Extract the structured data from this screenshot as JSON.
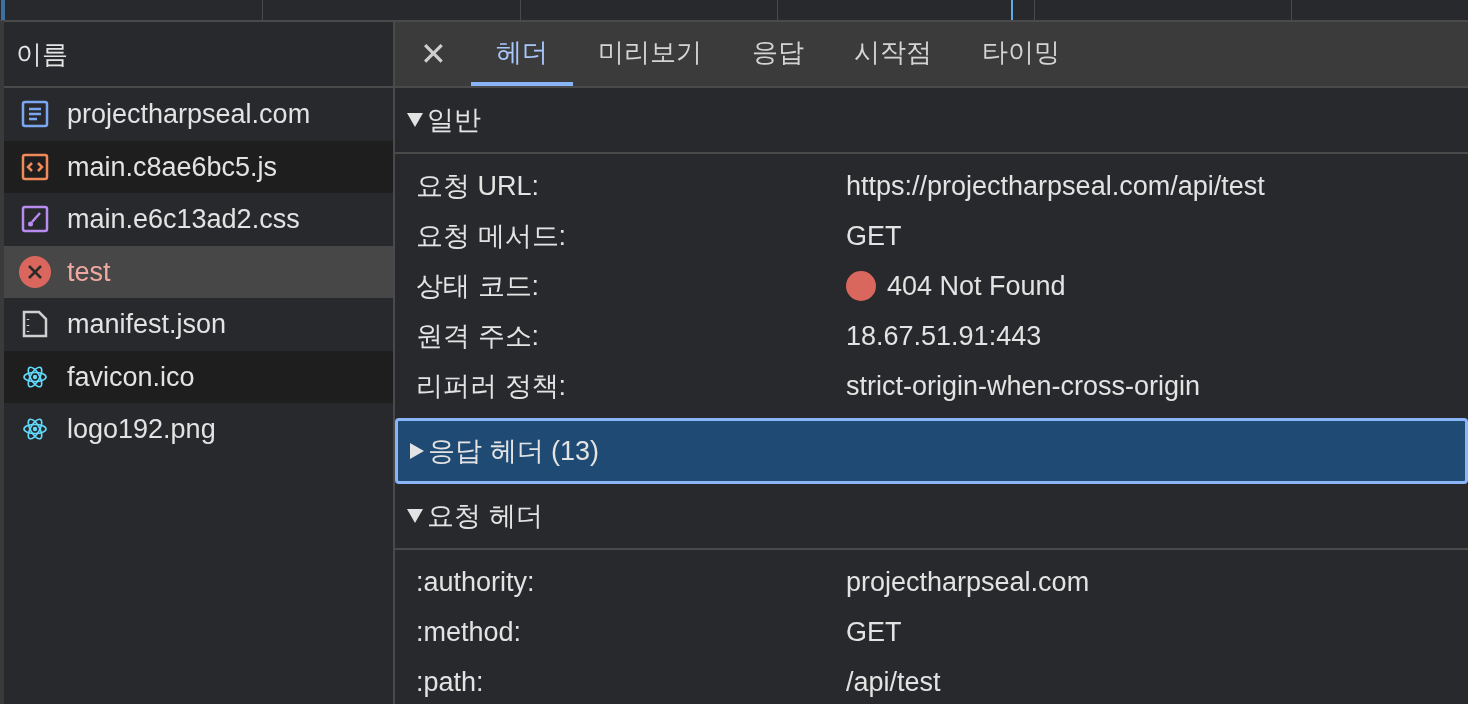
{
  "file_list": {
    "header": "이름",
    "items": [
      {
        "name": "projectharpseal.com",
        "kind": "document",
        "selected": false
      },
      {
        "name": "main.c8ae6bc5.js",
        "kind": "script",
        "selected": false
      },
      {
        "name": "main.e6c13ad2.css",
        "kind": "stylesheet",
        "selected": false
      },
      {
        "name": "test",
        "kind": "error",
        "selected": true
      },
      {
        "name": "manifest.json",
        "kind": "manifest",
        "selected": false
      },
      {
        "name": "favicon.ico",
        "kind": "react",
        "selected": false
      },
      {
        "name": "logo192.png",
        "kind": "react",
        "selected": false
      }
    ]
  },
  "close_label": "✕",
  "tabs": [
    {
      "label": "헤더",
      "selected": true
    },
    {
      "label": "미리보기",
      "selected": false
    },
    {
      "label": "응답",
      "selected": false
    },
    {
      "label": "시작점",
      "selected": false
    },
    {
      "label": "타이밍",
      "selected": false
    }
  ],
  "sections": [
    {
      "title": "일반",
      "expanded": true,
      "selected": false,
      "rows": [
        {
          "key": "요청 URL:",
          "value": "https://projectharpseal.com/api/test"
        },
        {
          "key": "요청 메서드:",
          "value": "GET"
        },
        {
          "key": "상태 코드:",
          "value": "404 Not Found",
          "color": "#d9675d"
        },
        {
          "key": "원격 주소:",
          "value": "18.67.51.91:443"
        },
        {
          "key": "리퍼러 정책:",
          "value": "strict-origin-when-cross-origin"
        }
      ]
    },
    {
      "title": "응답 헤더 (13)",
      "expanded": false,
      "selected": true
    },
    {
      "title": "요청 헤더",
      "expanded": true,
      "selected": false,
      "rows": [
        {
          "key": ":authority:",
          "value": "projectharpseal.com"
        },
        {
          "key": ":method:",
          "value": "GET"
        },
        {
          "key": ":path:",
          "value": "/api/test"
        }
      ]
    }
  ]
}
